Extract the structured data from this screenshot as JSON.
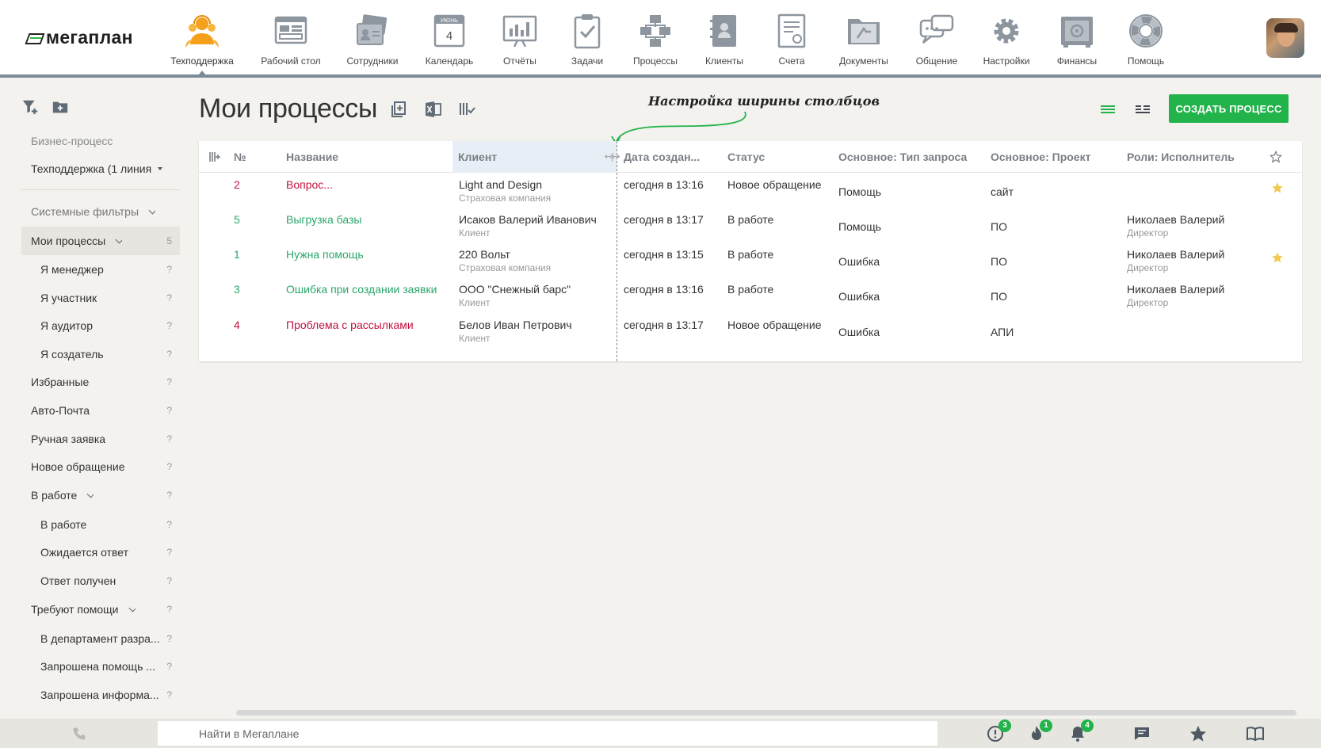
{
  "logo": {
    "text": "мегаплан"
  },
  "nav": [
    {
      "key": "support",
      "label": "Техподдержка",
      "icon": "support-agents-icon",
      "active": true
    },
    {
      "key": "desktop",
      "label": "Рабочий стол",
      "icon": "desktop-icon"
    },
    {
      "key": "employees",
      "label": "Сотрудники",
      "icon": "employees-icon"
    },
    {
      "key": "calendar",
      "label": "Календарь",
      "icon": "calendar-icon",
      "month": "ИЮНЬ",
      "day": "4"
    },
    {
      "key": "reports",
      "label": "Отчёты",
      "icon": "reports-icon"
    },
    {
      "key": "tasks",
      "label": "Задачи",
      "icon": "tasks-icon"
    },
    {
      "key": "processes",
      "label": "Процессы",
      "icon": "processes-icon"
    },
    {
      "key": "clients",
      "label": "Клиенты",
      "icon": "clients-icon"
    },
    {
      "key": "invoices",
      "label": "Счета",
      "icon": "invoices-icon"
    },
    {
      "key": "documents",
      "label": "Документы",
      "icon": "documents-icon"
    },
    {
      "key": "chat",
      "label": "Общение",
      "icon": "chat-icon"
    },
    {
      "key": "settings",
      "label": "Настройки",
      "icon": "settings-icon"
    },
    {
      "key": "finance",
      "label": "Финансы",
      "icon": "finance-icon"
    },
    {
      "key": "help",
      "label": "Помощь",
      "icon": "help-icon"
    }
  ],
  "sidebar": {
    "section_label": "Бизнес-процесс",
    "process_select": "Техподдержка (1 линия",
    "items": [
      {
        "label": "Системные фильтры",
        "count": "",
        "level": 0,
        "header": true,
        "chevron": true
      },
      {
        "label": "Мои процессы",
        "count": "5",
        "level": 0,
        "selected": true,
        "chevron": true
      },
      {
        "label": "Я менеджер",
        "count": "?",
        "level": 1
      },
      {
        "label": "Я участник",
        "count": "?",
        "level": 1
      },
      {
        "label": "Я аудитор",
        "count": "?",
        "level": 1
      },
      {
        "label": "Я создатель",
        "count": "?",
        "level": 1
      },
      {
        "label": "Избранные",
        "count": "?",
        "level": 0
      },
      {
        "label": "Авто-Почта",
        "count": "?",
        "level": 0
      },
      {
        "label": "Ручная заявка",
        "count": "?",
        "level": 0
      },
      {
        "label": "Новое обращение",
        "count": "?",
        "level": 0
      },
      {
        "label": "В работе",
        "count": "?",
        "level": 0,
        "chevron": true
      },
      {
        "label": "В работе",
        "count": "?",
        "level": 1
      },
      {
        "label": "Ожидается ответ",
        "count": "?",
        "level": 1
      },
      {
        "label": "Ответ получен",
        "count": "?",
        "level": 1
      },
      {
        "label": "Требуют помощи",
        "count": "?",
        "level": 0,
        "chevron": true
      },
      {
        "label": "В департамент разра...",
        "count": "?",
        "level": 1
      },
      {
        "label": "Запрошена помощь ...",
        "count": "?",
        "level": 1
      },
      {
        "label": "Запрошена информа...",
        "count": "?",
        "level": 1
      }
    ]
  },
  "main": {
    "title": "Мои процессы",
    "hint": "Настройка ширины столбцов",
    "create_button": "СОЗДАТЬ ПРОЦЕСС"
  },
  "table": {
    "columns": {
      "num": "№",
      "name": "Название",
      "client": "Клиент",
      "created": "Дата создан...",
      "status": "Статус",
      "type": "Основное: Тип запроса",
      "project": "Основное: Проект",
      "role": "Роли: Исполнитель"
    },
    "rows": [
      {
        "num": "2",
        "name": "Вопрос...",
        "client": "Light and Design",
        "client_type": "Страховая компания",
        "created": "сегодня в 13:16",
        "status": "Новое обращение",
        "type": "Помощь",
        "project": "сайт",
        "role": "",
        "role_sub": "",
        "starred": true,
        "color": "#c0123c"
      },
      {
        "num": "5",
        "name": "Выгрузка базы",
        "client": "Исаков Валерий Иванович",
        "client_type": "Клиент",
        "created": "сегодня в 13:17",
        "status": "В работе",
        "type": "Помощь",
        "project": "ПО",
        "role": "Николаев Валерий",
        "role_sub": "Директор",
        "starred": false,
        "color": "#2aa66a"
      },
      {
        "num": "1",
        "name": "Нужна помощь",
        "client": "220 Вольт",
        "client_type": "Страховая компания",
        "created": "сегодня в 13:15",
        "status": "В работе",
        "type": "Ошибка",
        "project": "ПО",
        "role": "Николаев Валерий",
        "role_sub": "Директор",
        "starred": true,
        "color": "#2aa66a"
      },
      {
        "num": "3",
        "name": "Ошибка при создании заявки",
        "client": "ООО \"Снежный барс\"",
        "client_type": "Клиент",
        "created": "сегодня в 13:16",
        "status": "В работе",
        "type": "Ошибка",
        "project": "ПО",
        "role": "Николаев Валерий",
        "role_sub": "Директор",
        "starred": false,
        "color": "#2aa66a"
      },
      {
        "num": "4",
        "name": "Проблема с рассылками",
        "client": "Белов Иван Петрович",
        "client_type": "Клиент",
        "created": "сегодня в 13:17",
        "status": "Новое обращение",
        "type": "Ошибка",
        "project": "АПИ",
        "role": "",
        "role_sub": "",
        "starred": false,
        "color": "#c0123c"
      }
    ]
  },
  "bottom": {
    "search_placeholder": "Найти в Мегаплане",
    "badges": {
      "alerts": "3",
      "hot": "1",
      "notifications": "4"
    }
  },
  "colors": {
    "accent": "#22b34a",
    "red": "#c0123c",
    "green": "#2aa66a",
    "star": "#f2c94c"
  }
}
